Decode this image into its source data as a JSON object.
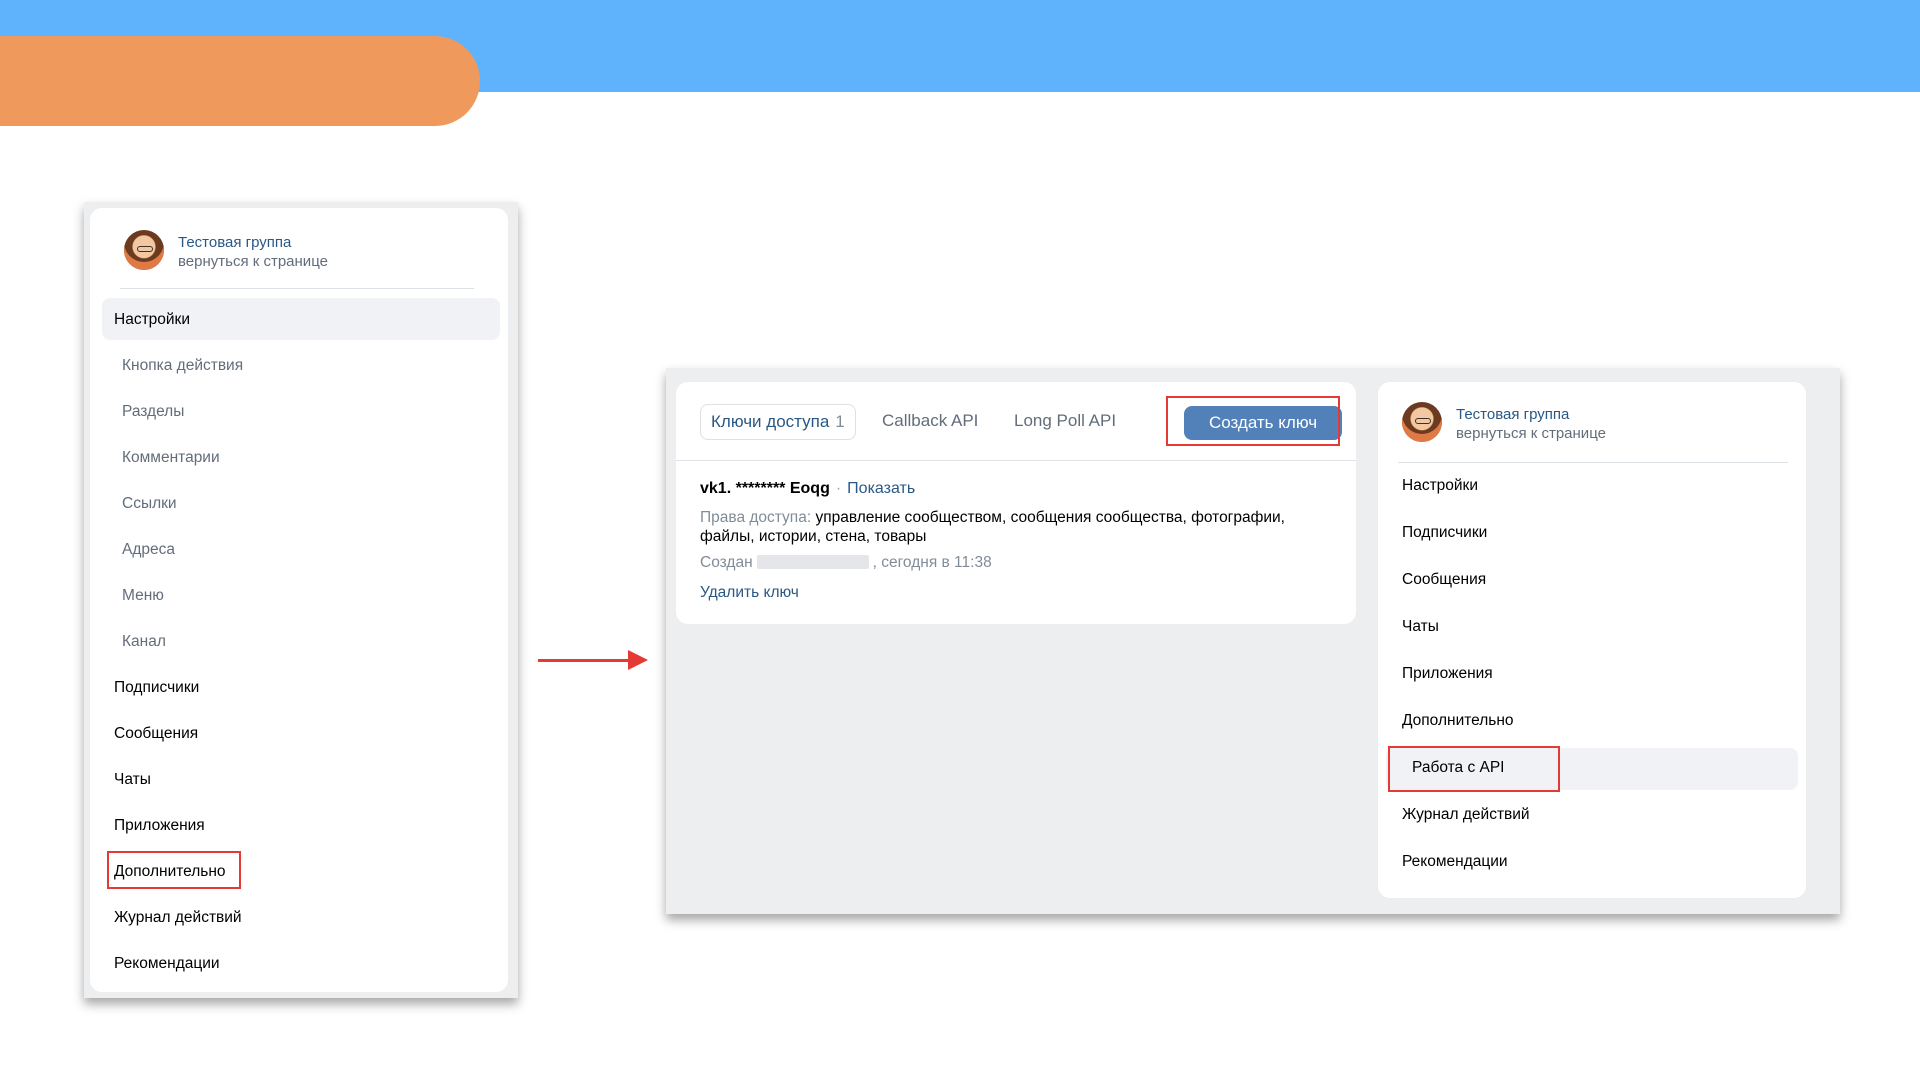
{
  "colors": {
    "top_bar": "#5fb2fc",
    "top_pill": "#f0995c",
    "highlight": "#e53935",
    "link": "#2a5885",
    "button": "#5181b8"
  },
  "left_panel": {
    "group_name": "Тестовая группа",
    "group_back": "вернуться к странице",
    "menu": [
      {
        "label": "Настройки",
        "type": "main",
        "active": true
      },
      {
        "label": "Кнопка действия",
        "type": "sub"
      },
      {
        "label": "Разделы",
        "type": "sub"
      },
      {
        "label": "Комментарии",
        "type": "sub"
      },
      {
        "label": "Ссылки",
        "type": "sub"
      },
      {
        "label": "Адреса",
        "type": "sub"
      },
      {
        "label": "Меню",
        "type": "sub"
      },
      {
        "label": "Канал",
        "type": "sub"
      },
      {
        "label": "Подписчики",
        "type": "main"
      },
      {
        "label": "Сообщения",
        "type": "main"
      },
      {
        "label": "Чаты",
        "type": "main"
      },
      {
        "label": "Приложения",
        "type": "main"
      },
      {
        "label": "Дополнительно",
        "type": "main",
        "highlighted": true
      },
      {
        "label": "Журнал действий",
        "type": "main"
      },
      {
        "label": "Рекомендации",
        "type": "main"
      }
    ]
  },
  "api_card": {
    "tabs": [
      {
        "label": "Ключи доступа",
        "count": "1",
        "active": true
      },
      {
        "label": "Callback API"
      },
      {
        "label": "Long Poll API"
      }
    ],
    "create_button": "Создать ключ",
    "key": {
      "value": "vk1. ******** Eoqg",
      "dot": "·",
      "show_link": "Показать",
      "rights_label": "Права доступа:",
      "rights_value": "управление сообществом, сообщения сообщества, фотографии, файлы, истории, стена, товары",
      "created_label": "Создан",
      "created_value": ", сегодня в 11:38",
      "delete_link": "Удалить ключ"
    }
  },
  "right_panel": {
    "group_name": "Тестовая группа",
    "group_back": "вернуться к странице",
    "menu": [
      {
        "label": "Настройки"
      },
      {
        "label": "Подписчики"
      },
      {
        "label": "Сообщения"
      },
      {
        "label": "Чаты"
      },
      {
        "label": "Приложения"
      },
      {
        "label": "Дополнительно"
      },
      {
        "label": "Работа с API",
        "active": true,
        "highlighted": true
      },
      {
        "label": "Журнал действий"
      },
      {
        "label": "Рекомендации"
      }
    ]
  }
}
